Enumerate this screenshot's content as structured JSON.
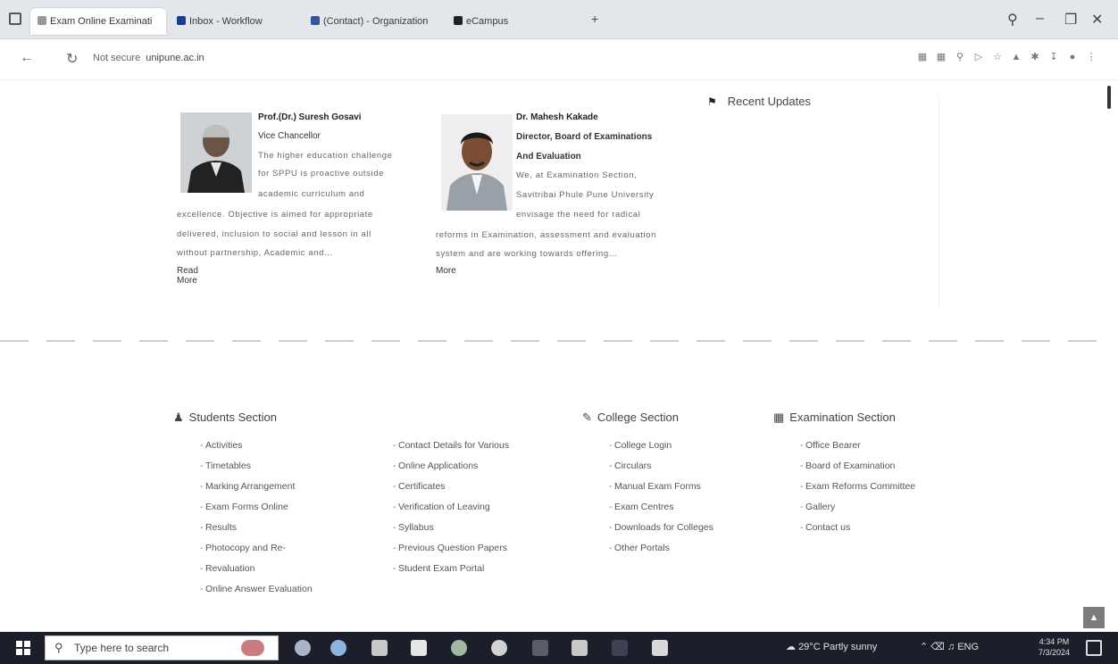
{
  "browser": {
    "tabs": [
      {
        "label": "Exam Online Examinati"
      },
      {
        "label": "Inbox - Workflow"
      },
      {
        "label": "(Contact) - Organization"
      },
      {
        "label": "eCampus"
      }
    ],
    "new_tab": "+",
    "url": "unipune.ac.in",
    "secure_label": "Not secure"
  },
  "profiles": [
    {
      "name": "Prof.(Dr.) Suresh Gosavi",
      "role": "Vice Chancellor",
      "lines": [
        "The higher education challenge",
        "for SPPU is proactive outside",
        "academic curriculum and",
        "excellence. Objective is aimed for appropriate",
        "delivered, inclusion to social and lesson in all",
        "without partnership, Academic and..."
      ],
      "more": "Read More"
    },
    {
      "name": "Dr. Mahesh Kakade",
      "role1": "Director, Board of Examinations",
      "role2": "And Evaluation",
      "lines": [
        "We, at Examination Section,",
        "Savitribai Phule Pune University",
        "envisage the need for radical",
        "reforms in Examination, assessment and evaluation",
        "system and are working towards offering..."
      ],
      "more": "More"
    }
  ],
  "updates": {
    "title": "Recent Updates"
  },
  "sections": [
    {
      "title": "Students Section",
      "items": [
        "Activities",
        "Timetables",
        "Marking Arrangement",
        "Exam Forms Online",
        "Results",
        "Photocopy and Re-",
        "Revaluation",
        "Online Answer Evaluation"
      ]
    },
    {
      "title": "",
      "items": [
        "Contact Details for Various",
        "Online Applications",
        "Certificates",
        "Verification of Leaving",
        "Syllabus",
        "Previous Question Papers",
        "Student Exam Portal"
      ]
    },
    {
      "title": "College Section",
      "items": [
        "College Login",
        "Circulars",
        "Manual Exam Forms",
        "Exam Centres",
        "Downloads for Colleges",
        "Other Portals"
      ]
    },
    {
      "title": "Examination Section",
      "items": [
        "Office Bearer",
        "Board of Examination",
        "Exam Reforms Committee",
        "Gallery",
        "Contact us"
      ]
    }
  ],
  "taskbar": {
    "search_placeholder": "Type here to search",
    "weather": "29°C Partly sunny",
    "lang": "ENG",
    "time": "4:34 PM",
    "date": "7/3/2024"
  }
}
